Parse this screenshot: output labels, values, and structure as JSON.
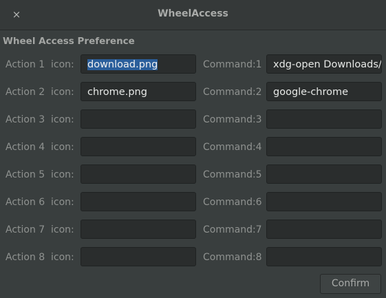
{
  "window": {
    "title": "WheelAccess",
    "close_icon": "×"
  },
  "heading": "Wheel Access Preference",
  "icon_label": "icon:",
  "rows": [
    {
      "action": "Action 1",
      "icon_value": "download.png",
      "command_label": "Command:1",
      "command_value": "xdg-open Downloads/"
    },
    {
      "action": "Action 2",
      "icon_value": "chrome.png",
      "command_label": "Command:2",
      "command_value": "google-chrome"
    },
    {
      "action": "Action 3",
      "icon_value": "",
      "command_label": "Command:3",
      "command_value": ""
    },
    {
      "action": "Action 4",
      "icon_value": "",
      "command_label": "Command:4",
      "command_value": ""
    },
    {
      "action": "Action 5",
      "icon_value": "",
      "command_label": "Command:5",
      "command_value": ""
    },
    {
      "action": "Action 6",
      "icon_value": "",
      "command_label": "Command:6",
      "command_value": ""
    },
    {
      "action": "Action 7",
      "icon_value": "",
      "command_label": "Command:7",
      "command_value": ""
    },
    {
      "action": "Action 8",
      "icon_value": "",
      "command_label": "Command:8",
      "command_value": ""
    }
  ],
  "confirm_label": "Confirm"
}
